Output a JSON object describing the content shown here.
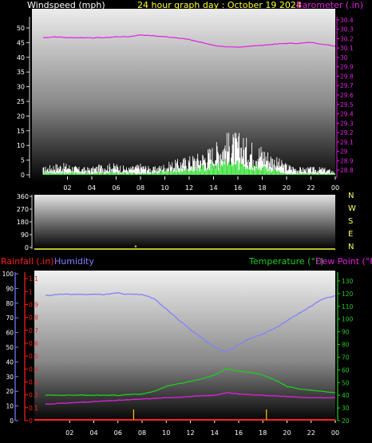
{
  "colors": {
    "background": "#000000",
    "wind_label": "#ffffff",
    "title": "#ffff33",
    "barometer": "#e020e0",
    "direction_label": "#ffff66",
    "rainfall": "#ff2020",
    "humidity": "#8080ff",
    "temperature": "#22cc22",
    "dewpoint": "#e020e0",
    "wind_gust": "#ffffff",
    "wind_avg": "#22dd22",
    "axis_gray": "#d8d8d8",
    "rain_tick": "#ffcc00"
  },
  "chart_data": [
    {
      "type": "line",
      "id": "wind-barometer",
      "title": "24 hour graph day : October 19 2024",
      "ylabel_left": "Windspeed (mph)",
      "ylabel_right": "Barometer (.in)",
      "x_ticks": [
        "02",
        "04",
        "06",
        "08",
        "10",
        "12",
        "14",
        "16",
        "18",
        "20",
        "22",
        "00"
      ],
      "x_range_hours": [
        0,
        24
      ],
      "y_left_ticks": [
        "0",
        "5",
        "10",
        "15",
        "20",
        "25",
        "30",
        "35",
        "40",
        "45",
        "50"
      ],
      "y_left_range": [
        0,
        50
      ],
      "y_right_ticks": [
        "28.8",
        "28.9",
        "29",
        "29.1",
        "29.2",
        "29.3",
        "29.4",
        "29.5",
        "29.6",
        "29.7",
        "29.8",
        "29.9",
        "30",
        "30.1",
        "30.2",
        "30.3",
        "30.4"
      ],
      "y_right_range": [
        28.75,
        30.45
      ],
      "series": [
        {
          "name": "Barometer (.in)",
          "axis": "right",
          "x": [
            0,
            1,
            2,
            3,
            4,
            5,
            6,
            7,
            8,
            9,
            10,
            11,
            12,
            13,
            14,
            15,
            16,
            17,
            18,
            19,
            20,
            21,
            22,
            23,
            24
          ],
          "values": [
            30.21,
            30.22,
            30.21,
            30.21,
            30.21,
            30.21,
            30.22,
            30.22,
            30.24,
            30.23,
            30.22,
            30.21,
            30.19,
            30.16,
            30.13,
            30.11,
            30.11,
            30.12,
            30.13,
            30.14,
            30.15,
            30.15,
            30.16,
            30.14,
            30.12
          ]
        }
      ],
      "gust_profile_mph": [
        [
          0,
          2
        ],
        [
          1,
          3
        ],
        [
          2,
          3
        ],
        [
          3,
          2
        ],
        [
          4,
          2
        ],
        [
          5,
          3
        ],
        [
          6,
          3
        ],
        [
          7,
          2
        ],
        [
          8,
          3
        ],
        [
          9,
          2
        ],
        [
          10,
          3
        ],
        [
          11,
          4
        ],
        [
          12,
          5
        ],
        [
          13,
          6
        ],
        [
          14,
          8
        ],
        [
          15,
          11
        ],
        [
          16,
          11
        ],
        [
          17,
          9
        ],
        [
          18,
          8
        ],
        [
          19,
          5
        ],
        [
          20,
          3
        ],
        [
          21,
          2
        ],
        [
          22,
          2
        ],
        [
          23,
          2
        ],
        [
          24,
          1
        ]
      ],
      "avg_profile_mph": [
        [
          0,
          0.8
        ],
        [
          2,
          0.8
        ],
        [
          4,
          0.6
        ],
        [
          6,
          0.8
        ],
        [
          8,
          0.5
        ],
        [
          10,
          1.2
        ],
        [
          12,
          2
        ],
        [
          14,
          3
        ],
        [
          15,
          4
        ],
        [
          16,
          4
        ],
        [
          17,
          3
        ],
        [
          18,
          2.5
        ],
        [
          19,
          1.5
        ],
        [
          20,
          0.5
        ],
        [
          22,
          0.5
        ],
        [
          24,
          0.3
        ]
      ]
    },
    {
      "type": "scatter",
      "id": "wind-direction",
      "y_ticks": [
        "360",
        "270",
        "180",
        "90",
        "0"
      ],
      "y_range": [
        0,
        360
      ],
      "compass": [
        "N",
        "W",
        "S",
        "E",
        "N"
      ],
      "x_ticks": [
        "02",
        "04",
        "06",
        "08",
        "10",
        "12",
        "14",
        "16",
        "18",
        "20",
        "22",
        "00"
      ],
      "series": [
        {
          "name": "Direction",
          "x": [
            7.6
          ],
          "values": [
            2
          ]
        }
      ]
    },
    {
      "type": "line",
      "id": "rain-humidity-temp",
      "legend_left": [
        "Rainfall (.in)",
        "Humidity"
      ],
      "legend_right": [
        "Temperature (°F)",
        "Dew Point (°F)"
      ],
      "humidity_ticks": [
        "0",
        "10",
        "20",
        "30",
        "40",
        "50",
        "60",
        "70",
        "80",
        "90",
        "100"
      ],
      "humidity_range": [
        0,
        100
      ],
      "rain_ticks": [
        "0",
        "0.1",
        "0.2",
        "0.3",
        "0.4",
        "0.5",
        "0.6",
        "0.7",
        "0.8",
        "0.9",
        "1",
        "1.1"
      ],
      "rain_range": [
        0,
        1.15
      ],
      "temp_ticks": [
        "20",
        "30",
        "40",
        "50",
        "60",
        "70",
        "80",
        "90",
        "100",
        "110",
        "120",
        "130"
      ],
      "temp_range": [
        20,
        135
      ],
      "x_ticks": [
        "02",
        "04",
        "06",
        "08",
        "10",
        "12",
        "14",
        "16",
        "18",
        "20",
        "22",
        "00"
      ],
      "series": [
        {
          "name": "Humidity",
          "axis": "humidity",
          "x": [
            0,
            1,
            2,
            3,
            4,
            5,
            6,
            6.5,
            7,
            8,
            9,
            10,
            11,
            12,
            13,
            14,
            14.5,
            15,
            15.5,
            16,
            17,
            18,
            19,
            20,
            21,
            22,
            23,
            24
          ],
          "values": [
            85,
            86,
            86,
            86,
            86,
            86,
            87,
            86,
            86,
            86,
            83,
            76,
            69,
            62,
            56,
            50,
            48,
            47,
            49,
            52,
            56,
            59,
            63,
            68,
            73,
            78,
            83,
            85
          ]
        },
        {
          "name": "Temperature (°F)",
          "axis": "temp",
          "x": [
            0,
            2,
            4,
            6,
            8,
            9,
            10,
            11,
            12,
            13,
            14,
            14.5,
            15,
            15.5,
            16,
            17,
            18,
            19,
            20,
            21,
            22,
            23,
            24
          ],
          "values": [
            40,
            40,
            40,
            40,
            41,
            43,
            47,
            49,
            51,
            53,
            56,
            58,
            61,
            60,
            59,
            58,
            56,
            52,
            47,
            45,
            44,
            43,
            42
          ],
          "color": "#22cc22"
        },
        {
          "name": "Dew Point (°F)",
          "axis": "temp",
          "x": [
            0,
            2,
            4,
            6,
            8,
            10,
            12,
            14,
            15,
            16,
            18,
            20,
            22,
            24
          ],
          "values": [
            33,
            34,
            35,
            36,
            37,
            38,
            39,
            40,
            42,
            41,
            40,
            39,
            38,
            38
          ],
          "color": "#e020e0"
        },
        {
          "name": "Rainfall (.in)",
          "axis": "rain",
          "x": [
            0,
            24
          ],
          "values": [
            0,
            0
          ]
        }
      ],
      "rain_marks_hours": [
        7.3,
        18.3
      ]
    }
  ]
}
